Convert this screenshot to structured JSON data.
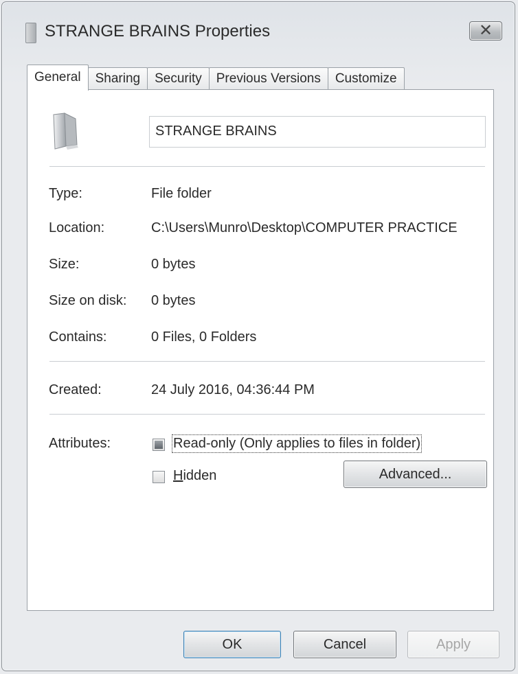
{
  "window": {
    "title": "STRANGE BRAINS Properties",
    "close_icon": "close-icon"
  },
  "tabs": [
    {
      "label": "General",
      "active": true
    },
    {
      "label": "Sharing",
      "active": false
    },
    {
      "label": "Security",
      "active": false
    },
    {
      "label": "Previous Versions",
      "active": false
    },
    {
      "label": "Customize",
      "active": false
    }
  ],
  "general": {
    "folder_icon": "folder-icon",
    "folder_name": "STRANGE BRAINS",
    "type_label": "Type:",
    "type_value": "File folder",
    "location_label": "Location:",
    "location_value": "C:\\Users\\Munro\\Desktop\\COMPUTER PRACTICE",
    "size_label": "Size:",
    "size_value": "0 bytes",
    "size_on_disk_label": "Size on disk:",
    "size_on_disk_value": "0 bytes",
    "contains_label": "Contains:",
    "contains_value": "0 Files, 0 Folders",
    "created_label": "Created:",
    "created_value": "24 July 2016, 04:36:44 PM",
    "attributes_label": "Attributes:",
    "readonly_label": "Read-only (Only applies to files in folder)",
    "readonly_state": "indeterminate",
    "hidden_label": "Hidden",
    "hidden_state": "unchecked",
    "advanced_label": "Advanced..."
  },
  "footer": {
    "ok_label": "OK",
    "cancel_label": "Cancel",
    "apply_label": "Apply"
  },
  "colors": {
    "window_bg": "#e9ebee",
    "panel_bg": "#ffffff",
    "border": "#9aa0a6",
    "default_button_accent": "#3c7fb1"
  }
}
